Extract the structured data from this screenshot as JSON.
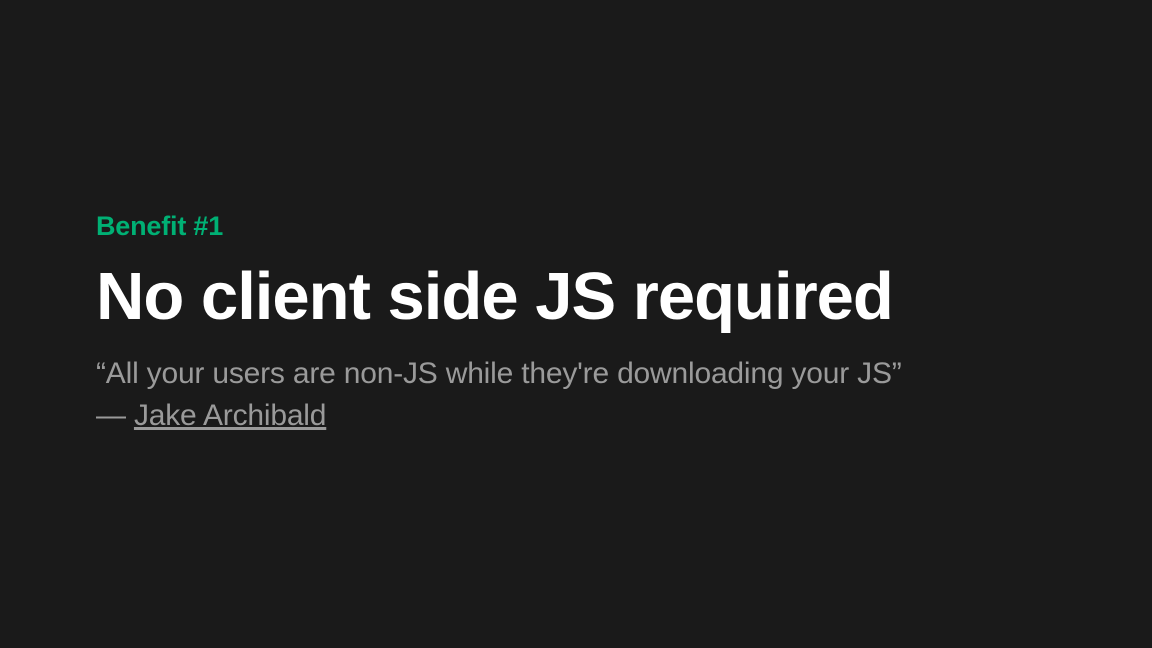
{
  "slide": {
    "eyebrow": "Benefit #1",
    "title": "No client side JS required",
    "quote": "“All your users are non-JS while they're downloading your JS”",
    "attribution_prefix": "— ",
    "author": "Jake Archibald"
  }
}
